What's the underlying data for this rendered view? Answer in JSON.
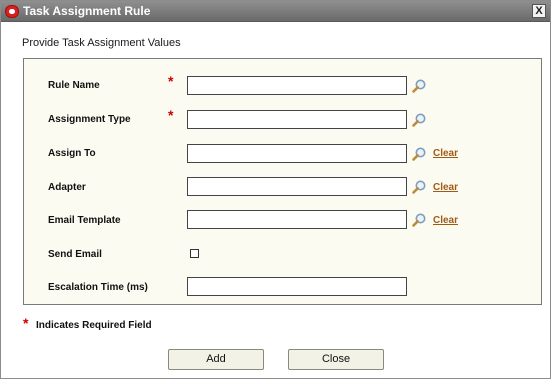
{
  "window": {
    "title": "Task Assignment Rule",
    "close_label": "X"
  },
  "subtitle": "Provide Task Assignment Values",
  "fields": [
    {
      "label": "Rule Name",
      "required": true,
      "value": "",
      "has_search": true,
      "clear_label": ""
    },
    {
      "label": "Assignment Type",
      "required": true,
      "value": "",
      "has_search": true,
      "clear_label": ""
    },
    {
      "label": "Assign To",
      "required": false,
      "value": "",
      "has_search": true,
      "clear_label": "Clear"
    },
    {
      "label": "Adapter",
      "required": false,
      "value": "",
      "has_search": true,
      "clear_label": "Clear"
    },
    {
      "label": "Email Template",
      "required": false,
      "value": "",
      "has_search": true,
      "clear_label": "Clear"
    }
  ],
  "send_email": {
    "label": "Send Email",
    "checked": false
  },
  "escalation": {
    "label": "Escalation Time (ms)",
    "value": ""
  },
  "required_star": "*",
  "required_note": "Indicates Required Field",
  "buttons": {
    "add": "Add",
    "close": "Close"
  },
  "colors": {
    "required": "#cc0000",
    "link": "#a05a14",
    "panel_bg": "#fbfbf1",
    "titlebar": "#7a7a7a"
  }
}
